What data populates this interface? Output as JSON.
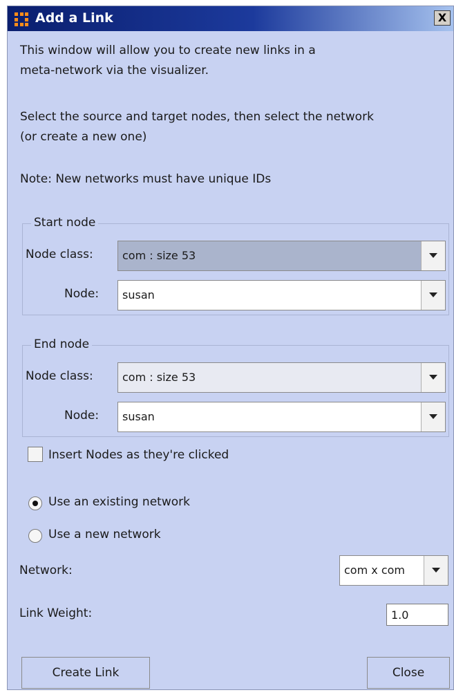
{
  "window": {
    "title": "Add a Link",
    "close_glyph": "X"
  },
  "intro": {
    "p1_line1": "This window will allow you to create new links in a",
    "p1_line2": "meta-network via the visualizer.",
    "p2_line1": "Select the source and target nodes, then select the network",
    "p2_line2": "(or create a new one)",
    "note": "Note: New networks must have unique IDs"
  },
  "start_node": {
    "title": "Start node",
    "class_label": "Node class:",
    "class_value": "com : size 53",
    "node_label": "Node:",
    "node_value": "susan"
  },
  "end_node": {
    "title": "End node",
    "class_label": "Node class:",
    "class_value": "com : size 53",
    "node_label": "Node:",
    "node_value": "susan"
  },
  "insert_checkbox": {
    "label": "Insert Nodes as they're clicked",
    "checked": false
  },
  "network_choice": {
    "existing_label": "Use an existing network",
    "new_label": "Use a new network",
    "selected": "existing"
  },
  "network": {
    "label": "Network:",
    "value": "com x com"
  },
  "link_weight": {
    "label": "Link Weight:",
    "value": "1.0"
  },
  "buttons": {
    "create": "Create Link",
    "close": "Close"
  },
  "colors": {
    "window_bg": "#c8d2f2",
    "title_gradient_start": "#0a1e6e",
    "icon_orange": "#ff8c1a"
  },
  "icons": {
    "app": "app-grid-icon",
    "close": "close-icon",
    "dropdown": "chevron-down-icon"
  }
}
